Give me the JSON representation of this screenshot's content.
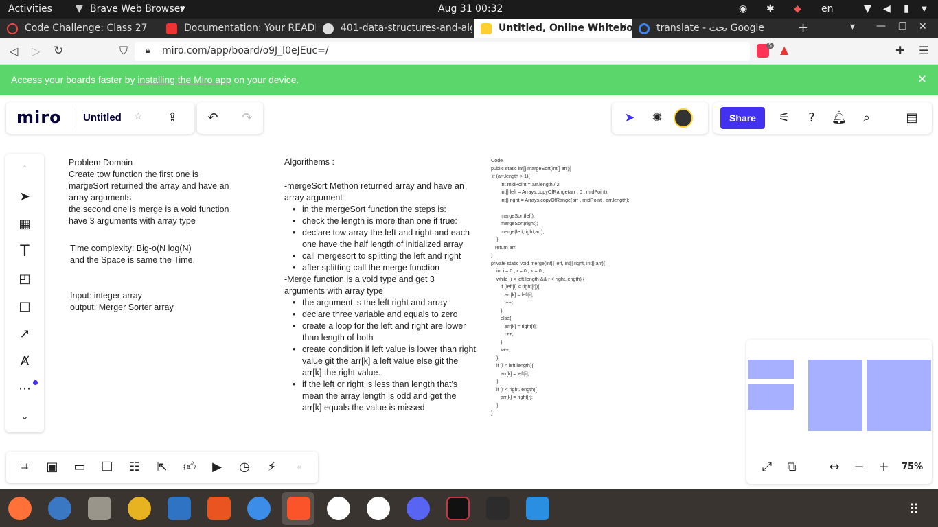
{
  "os": {
    "activities": "Activities",
    "app_name": "Brave Web Browser",
    "clock": "Aug 31  00:32",
    "lang": "en"
  },
  "tabs": [
    {
      "title": "Code Challenge: Class 27",
      "color": "#e44"
    },
    {
      "title": "Documentation: Your READI",
      "color": "#e33"
    },
    {
      "title": "401-data-structures-and-alg",
      "color": "#ddd"
    },
    {
      "title": "Untitled, Online Whitebo",
      "color": "#ffd02f"
    },
    {
      "title": "translate - بحث Google",
      "color": "#4285f4"
    }
  ],
  "browser": {
    "url": "miro.com/app/board/o9J_l0eJEuc=/",
    "shield_count": "5"
  },
  "banner": {
    "text_before": "Access your boards faster by ",
    "link": "installing the Miro app",
    "text_after": " on your device."
  },
  "miro": {
    "logo": "miro",
    "board_title": "Untitled",
    "share_label": "Share",
    "zoom": "75%"
  },
  "board": {
    "col1": {
      "p1": [
        "Problem Domain",
        "Create tow function the first one is",
        "margeSort returned the array and have an",
        "array arguments",
        "the second one is merge is a void function",
        "have 3 arguments with array type"
      ],
      "p2": [
        "Time complexity: Big-o(N log(N)",
        "and the Space is same the Time."
      ],
      "p3": [
        "Input: integer array",
        "output: Merger Sorter array"
      ]
    },
    "col2": {
      "title": "Algorithems :",
      "merge_sort_head": "-mergeSort Methon returned array and have an array argument",
      "merge_sort_steps": [
        "in the mergeSort function the steps is:",
        "check the length is more than one if true:",
        "declare tow array the left and right and each one have the half length of initialized array",
        "call mergesort to splitting the left and right",
        "after splitting call the merge function"
      ],
      "merge_head": "-Merge function is a void type and get 3 arguments with array type",
      "merge_steps": [
        "the argument is the left right and array",
        "declare three variable and equals to zero",
        "create a loop for the left and right are lower than length of both",
        "create condition if left value is lower than right value git the arr[k] a left value else git the arr[k] the right value.",
        "if the left or right is less than length that's mean the array length is odd and get the arr[k] equals the value is missed"
      ]
    },
    "code": "Code\npublic static int[] margeSort(int[] arr){\n if (arr.length > 1){\n       int midPoint = arr.length / 2;\n       int[] left = Arrays.copyOfRange(arr , 0 , midPoint);\n       int[] right = Arrays.copyOfRange(arr , midPoint , arr.length);\n\n       margeSort(left);\n       margeSort(right);\n       merge(left,right,arr);\n    }\n   return arr;\n}\nprivate static void merge(int[] left, int[] right, int[] arr){\n    int i = 0 , r = 0 , k = 0 ;\n    while (i < left.length && r < right.length) {\n       if (left[i] < right[r]){\n          arr[k] = left[i];\n          i++;\n       }\n       else{\n          arr[k] = right[r];\n          r++;\n       }\n       k++;\n    }\n    if (i < left.length){\n       arr[k] = left[i];\n    }\n    if (r < right.length){\n       arr[k] = right[r];\n    }\n}"
  },
  "colors": {
    "miro_purple": "#4331f2",
    "banner_green": "#5ad66a",
    "minimap_block": "#a7b0ff"
  }
}
